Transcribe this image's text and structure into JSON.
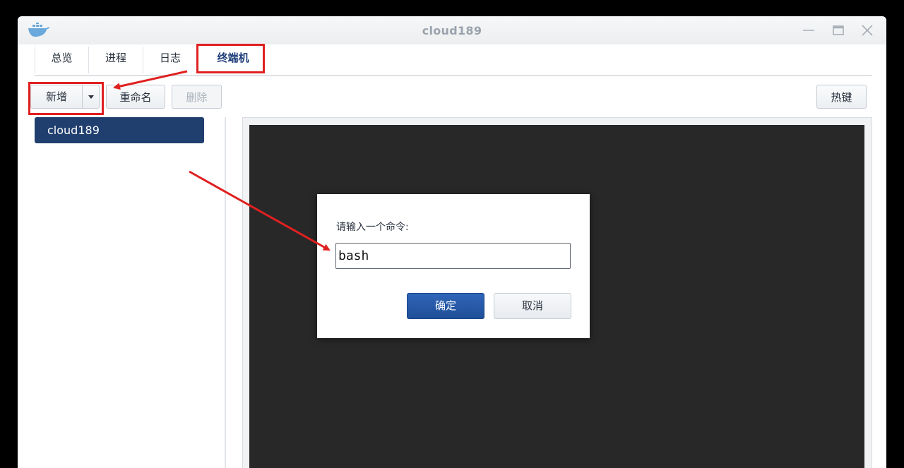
{
  "window": {
    "title": "cloud189",
    "app_icon": "docker-whale-icon"
  },
  "tabs": [
    {
      "label": "总览"
    },
    {
      "label": "进程"
    },
    {
      "label": "日志"
    },
    {
      "label": "终端机",
      "active": true
    }
  ],
  "toolbar": {
    "add_label": "新增",
    "rename_label": "重命名",
    "delete_label": "删除",
    "hotkey_label": "热键"
  },
  "sidebar": {
    "items": [
      {
        "label": "cloud189",
        "selected": true
      }
    ]
  },
  "dialog": {
    "prompt_label": "请输入一个命令:",
    "command_value": "bash",
    "ok_label": "确定",
    "cancel_label": "取消"
  },
  "colors": {
    "accent": "#203f6e",
    "primary_button": "#2a5cab",
    "annotation_red": "#e02020",
    "terminal_bg": "#282828"
  }
}
